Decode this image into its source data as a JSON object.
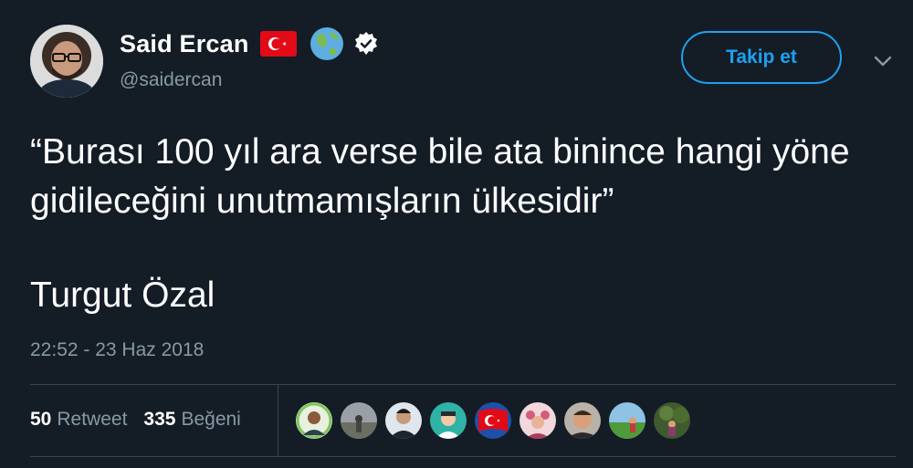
{
  "user": {
    "display_name": "Said Ercan",
    "handle": "@saidercan",
    "emoji_icons": [
      "turkey-flag-icon",
      "globe-icon",
      "verified-badge-icon"
    ]
  },
  "follow_button": {
    "label": "Takip et"
  },
  "tweet": {
    "text": "“Burası 100 yıl ara verse bile ata binince hangi yöne gidileceğini unutmamışların ülkesidir”",
    "author_line": "Turgut Özal",
    "timestamp": "22:52 - 23 Haz 2018"
  },
  "stats": {
    "retweets": "50",
    "retweet_label": "Retweet",
    "likes": "335",
    "like_label": "Beğeni"
  },
  "likers": [
    {
      "icon": "liker-avatar-1"
    },
    {
      "icon": "liker-avatar-2"
    },
    {
      "icon": "liker-avatar-3"
    },
    {
      "icon": "liker-avatar-4"
    },
    {
      "icon": "liker-avatar-5"
    },
    {
      "icon": "liker-avatar-6"
    },
    {
      "icon": "liker-avatar-7"
    },
    {
      "icon": "liker-avatar-8"
    },
    {
      "icon": "liker-avatar-9"
    }
  ],
  "colors": {
    "background": "#141d26",
    "accent": "#1da1f2",
    "secondary_text": "#8899a6",
    "divider": "#38444d"
  }
}
